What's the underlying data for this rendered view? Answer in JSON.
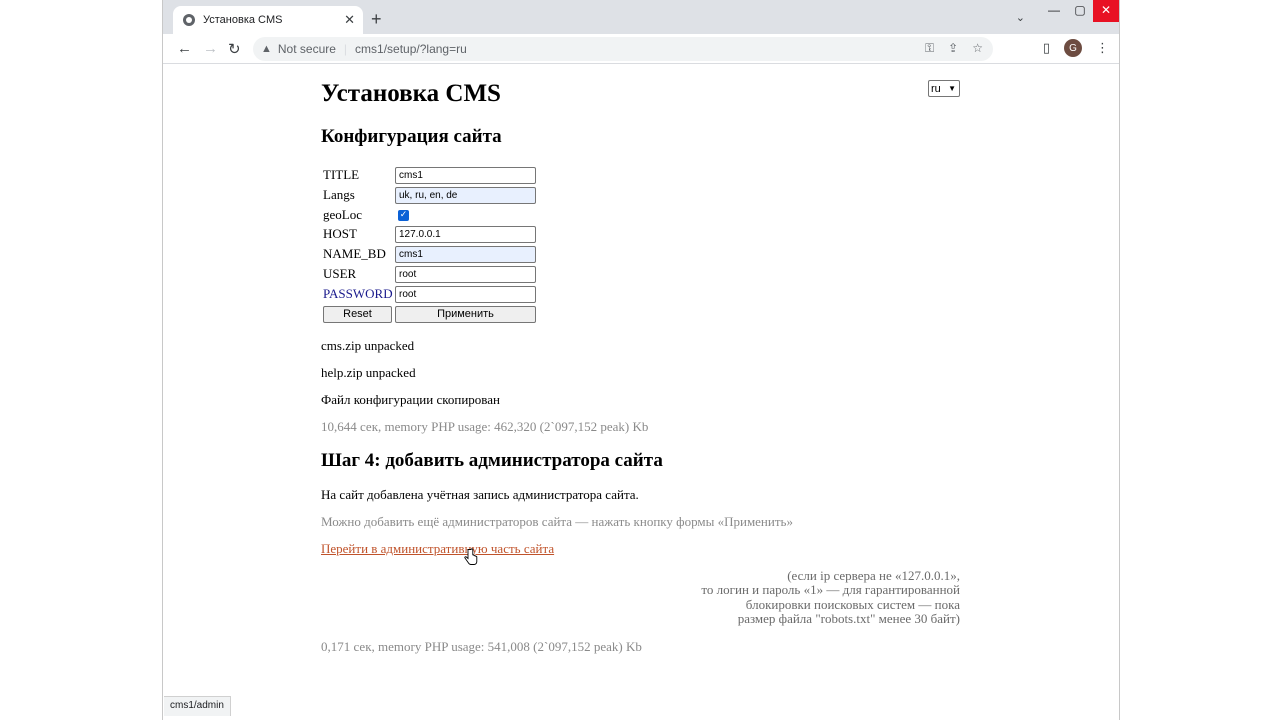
{
  "browser": {
    "tab_title": "Установка CMS",
    "tab_close": "✕",
    "new_tab": "+",
    "tab_menu": "⌄",
    "win_min": "—",
    "win_max": "▢",
    "win_close": "✕",
    "back": "←",
    "forward": "→",
    "reload": "↻",
    "security_icon": "▲",
    "security_text": "Not secure",
    "url": "cms1/setup/?lang=ru",
    "profile_initial": "G",
    "status_url": "cms1/admin"
  },
  "page": {
    "title": "Установка CMS",
    "lang_selected": "ru",
    "config_heading": "Конфигурация сайта",
    "form": {
      "title_label": "TITLE",
      "title_value": "cms1",
      "langs_label": "Langs",
      "langs_value": "uk, ru, en, de",
      "geoloc_label": "geoLoc",
      "geoloc_checked": true,
      "host_label": "HOST",
      "host_value": "127.0.0.1",
      "namebd_label": "NAME_BD",
      "namebd_value": "cms1",
      "user_label": "USER",
      "user_value": "root",
      "password_label": "PASSWORD",
      "password_value": "root",
      "reset_label": "Reset",
      "apply_label": "Применить"
    },
    "log": {
      "line1": "cms.zip unpacked",
      "line2": "help.zip unpacked",
      "line3": "Файл конфигурации скопирован",
      "timing1": "10,644 сек, memory PHP usage: 462,320 (2`097,152 peak) Kb"
    },
    "step4_heading": "Шаг 4: добавить администратора сайта",
    "admin_added": "На сайт добавлена учётная запись администратора сайта.",
    "admin_hint": "Можно добавить ещё администраторов сайта — нажать кнопку формы «Применить»",
    "admin_link": "Перейти в административную часть сайта",
    "note": {
      "line1": "(если ip сервера не «127.0.0.1»,",
      "line2": "то логин и пароль «1» — для гарантированной",
      "line3": "блокировки поисковых систем — пока",
      "line4": "размер файла \"robots.txt\" менее 30 байт)"
    },
    "timing2": "0,171 сек, memory PHP usage: 541,008 (2`097,152 peak) Kb"
  },
  "colors": {
    "link": "#c0532b",
    "muted_text": "#8a8a8a",
    "autofill_bg": "#e8f0fe",
    "checkbox": "#0b61d6"
  }
}
